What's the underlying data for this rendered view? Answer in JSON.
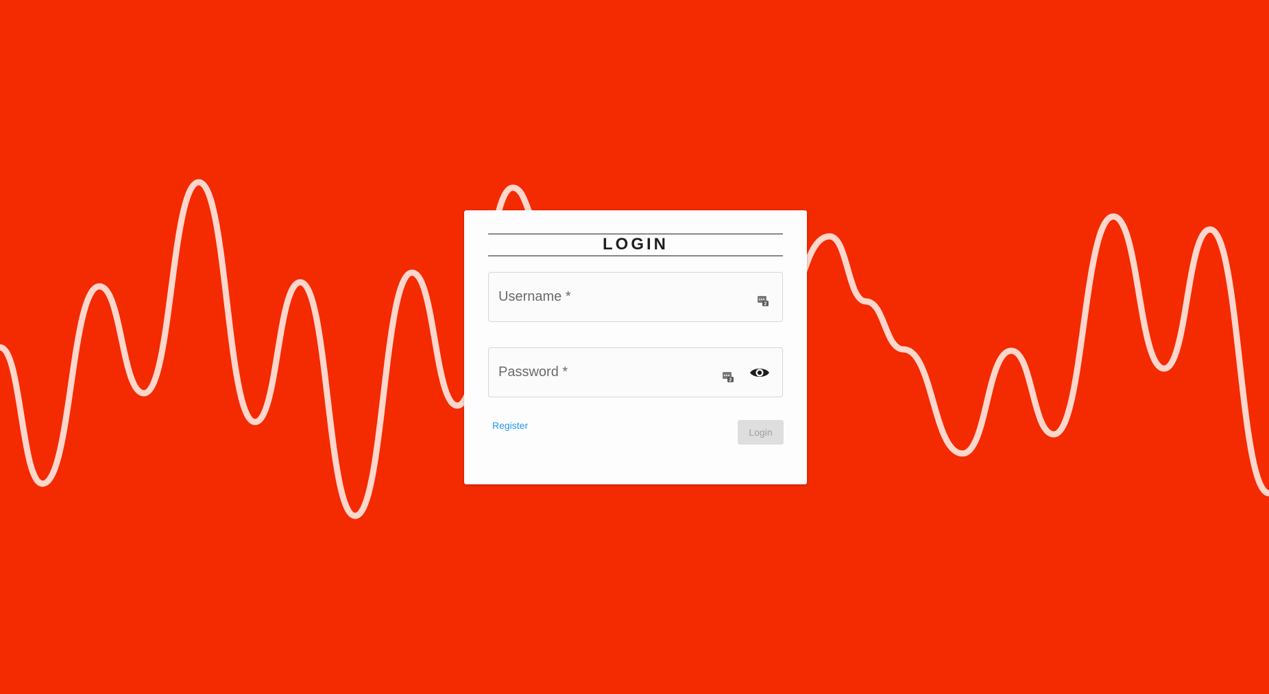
{
  "background": {
    "color": "#f42a00",
    "wave_color": "#ffd6cc"
  },
  "login_card": {
    "title": "LOGIN",
    "username": {
      "placeholder": "Username *",
      "value": "",
      "icon": "keepass-autofill-icon"
    },
    "password": {
      "placeholder": "Password *",
      "value": "",
      "icon": "keepass-autofill-icon",
      "toggle_icon": "eye-icon"
    },
    "register_label": "Register",
    "login_label": "Login",
    "login_enabled": false,
    "link_color": "#2196f3"
  }
}
